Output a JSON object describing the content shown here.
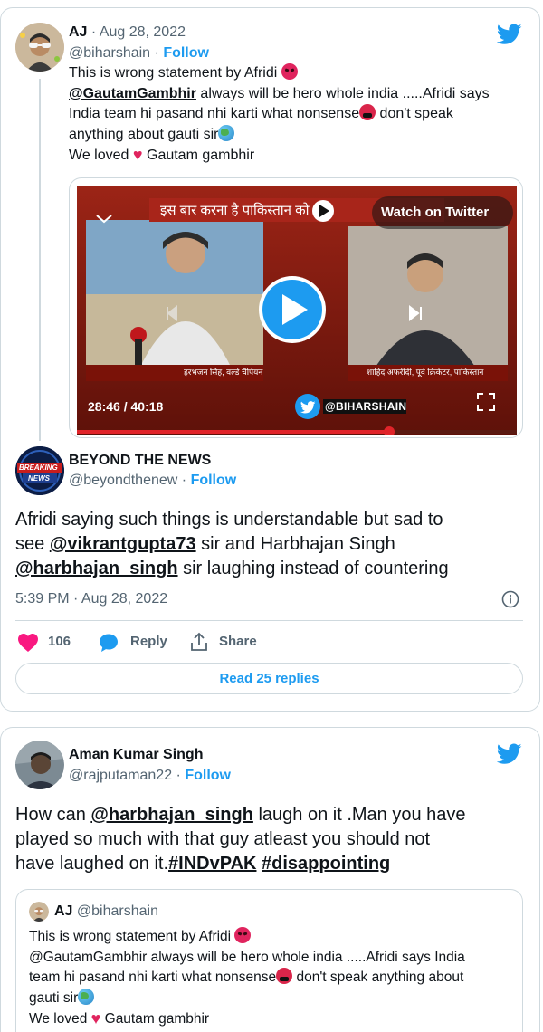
{
  "tweet1": {
    "author_name": "AJ",
    "separator": "·",
    "date": "Aug 28, 2022",
    "handle": "@biharshain",
    "follow": "Follow",
    "line1": "This is wrong statement by Afridi ",
    "line2_mention": "@GautamGambhir",
    "line2_rest": " always will be hero whole india .....Afridi says",
    "line3": "India team hi pasand nhi karti what nonsense",
    "line3_rest": " don't speak",
    "line4": "anything about gauti sir",
    "line5_a": "We loved ",
    "line5_b": " Gautam gambhir",
    "video": {
      "watch_label": "Watch on Twitter",
      "time": "28:46 / 40:18",
      "banner": "इस बार करना है पाकिस्तान को",
      "caption_left": "हरभजन सिंह, वर्ल्ड चैंपियन",
      "caption_right": "शाहिद अफरीदी, पूर्व क्रिकेटर, पाकिस्तान",
      "watermark": "@BIHARSHAIN",
      "progress": 0.71
    }
  },
  "tweet2": {
    "author_name": "BEYOND THE NEWS",
    "handle": "@beyondthenew",
    "separator": "·",
    "follow": "Follow",
    "avatar_text_1": "BREAKING",
    "avatar_text_2": "NEWS",
    "body_1": "Afridi saying such things is understandable but sad to",
    "body_2a": "see ",
    "body_2_mention": "@vikrantgupta73",
    "body_2b": " sir and Harbhajan Singh",
    "body_3_mention": "@harbhajan_singh",
    "body_3b": " sir laughing instead of countering",
    "timestamp": "5:39 PM · Aug 28, 2022",
    "likes": "106",
    "reply": "Reply",
    "share": "Share",
    "read_replies": "Read 25 replies"
  },
  "tweet3": {
    "author_name": "Aman Kumar Singh",
    "handle": "@rajputaman22",
    "separator": "·",
    "follow": "Follow",
    "body_1a": "How can ",
    "body_1_mention": "@harbhajan_singh",
    "body_1b": " laugh on it .Man you have",
    "body_2": "played so much with that guy atleast you should not",
    "body_3a": "have laughed on it.",
    "hashtag_1": "#INDvPAK",
    "hashtag_2": "#disappointing",
    "quote": {
      "author_name": "AJ",
      "handle": "@biharshain",
      "line1": "This is wrong statement by Afridi ",
      "line2": "@GautamGambhir always will be hero whole india .....Afridi says India",
      "line3a": "team hi pasand nhi karti what nonsense",
      "line3b": " don't speak anything about",
      "line4": "gauti sir",
      "line5a": "We loved ",
      "line5b": " Gautam gambhir"
    }
  },
  "colors": {
    "twitter_blue": "#1d9bf0",
    "like_pink": "#f91880",
    "muted": "#536471",
    "border": "#cfd9de"
  }
}
